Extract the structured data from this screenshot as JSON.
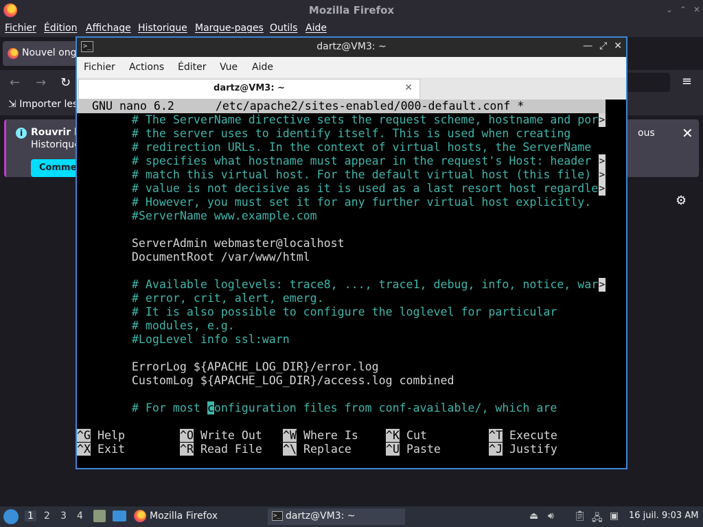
{
  "firefox": {
    "window_title": "Mozilla Firefox",
    "menu": [
      "Fichier",
      "Édition",
      "Affichage",
      "Historique",
      "Marque-pages",
      "Outils",
      "Aide"
    ],
    "tab_label": "Nouvel ongl",
    "bookmarks_item": "Importer les",
    "notice": {
      "title": "Rouvrir le",
      "subtitle": "Historique",
      "button": "Commen",
      "right_text": "ous"
    }
  },
  "terminal": {
    "window_title": "dartz@VM3: ~",
    "menu": [
      "Fichier",
      "Actions",
      "Éditer",
      "Vue",
      "Aide"
    ],
    "tab_label": "dartz@VM3: ~"
  },
  "nano": {
    "header": "GNU nano 6.2      /etc/apache2/sites-enabled/000-default.conf *",
    "lines": [
      {
        "text": "        # The ServerName directive sets the request scheme, hostname and por",
        "type": "comment",
        "overflow": true
      },
      {
        "text": "        # the server uses to identify itself. This is used when creating",
        "type": "comment",
        "overflow": false
      },
      {
        "text": "        # redirection URLs. In the context of virtual hosts, the ServerName",
        "type": "comment",
        "overflow": false
      },
      {
        "text": "        # specifies what hostname must appear in the request's Host: header",
        "type": "comment",
        "overflow": true
      },
      {
        "text": "        # match this virtual host. For the default virtual host (this file)",
        "type": "comment",
        "overflow": true
      },
      {
        "text": "        # value is not decisive as it is used as a last resort host regardle",
        "type": "comment",
        "overflow": true
      },
      {
        "text": "        # However, you must set it for any further virtual host explicitly.",
        "type": "comment",
        "overflow": false
      },
      {
        "text": "        #ServerName www.example.com",
        "type": "comment",
        "overflow": false
      },
      {
        "text": "",
        "type": "text",
        "overflow": false
      },
      {
        "text": "        ServerAdmin webmaster@localhost",
        "type": "text",
        "overflow": false
      },
      {
        "text": "        DocumentRoot /var/www/html",
        "type": "text",
        "overflow": false
      },
      {
        "text": "",
        "type": "text",
        "overflow": false
      },
      {
        "text": "        # Available loglevels: trace8, ..., trace1, debug, info, notice, war",
        "type": "comment",
        "overflow": true
      },
      {
        "text": "        # error, crit, alert, emerg.",
        "type": "comment",
        "overflow": false
      },
      {
        "text": "        # It is also possible to configure the loglevel for particular",
        "type": "comment",
        "overflow": false
      },
      {
        "text": "        # modules, e.g.",
        "type": "comment",
        "overflow": false
      },
      {
        "text": "        #LogLevel info ssl:warn",
        "type": "comment",
        "overflow": false
      },
      {
        "text": "",
        "type": "text",
        "overflow": false
      },
      {
        "text": "        ErrorLog ${APACHE_LOG_DIR}/error.log",
        "type": "text",
        "overflow": false
      },
      {
        "text": "        CustomLog ${APACHE_LOG_DIR}/access.log combined",
        "type": "text",
        "overflow": false
      },
      {
        "text": "",
        "type": "text",
        "overflow": false
      },
      {
        "text": "        # For most configuration files from conf-available/, which are",
        "type": "comment",
        "overflow": false,
        "cursor_col": 19
      }
    ],
    "shortcuts_row1": [
      {
        "key": "^G",
        "label": " Help"
      },
      {
        "key": "^O",
        "label": " Write Out"
      },
      {
        "key": "^W",
        "label": " Where Is"
      },
      {
        "key": "^K",
        "label": " Cut"
      },
      {
        "key": "^T",
        "label": " Execute"
      }
    ],
    "shortcuts_row2": [
      {
        "key": "^X",
        "label": " Exit"
      },
      {
        "key": "^R",
        "label": " Read File"
      },
      {
        "key": "^\\",
        "label": " Replace"
      },
      {
        "key": "^U",
        "label": " Paste"
      },
      {
        "key": "^J",
        "label": " Justify"
      }
    ]
  },
  "taskbar": {
    "workspaces": [
      "1",
      "2",
      "3",
      "4"
    ],
    "active_workspace": "1",
    "tasks": [
      {
        "label": "Mozilla Firefox",
        "icon": "firefox-icon"
      },
      {
        "label": "dartz@VM3: ~",
        "icon": "terminal-icon"
      }
    ],
    "clock": "16 juil. 9:03 AM"
  },
  "colors": {
    "accent": "#3c87d6",
    "nano_comment": "#3fb5aa",
    "nano_text": "#d6d6d6",
    "nano_bar": "#c8c8c8"
  }
}
